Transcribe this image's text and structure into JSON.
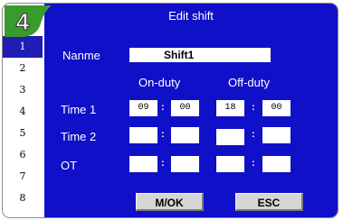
{
  "step_number": "4",
  "sidebar": {
    "items": [
      "1",
      "2",
      "3",
      "4",
      "5",
      "6",
      "7",
      "8"
    ],
    "active_index": 0
  },
  "dialog": {
    "title": "Edit shift",
    "name_label": "Nanme",
    "name_value": "Shift1",
    "on_duty_label": "On-duty",
    "off_duty_label": "Off-duty",
    "separator": ":",
    "rows": [
      {
        "label": "Time 1",
        "on_hour": "09",
        "on_min": "00",
        "off_hour": "18",
        "off_min": "00"
      },
      {
        "label": "Time 2",
        "on_hour": "",
        "on_min": "",
        "off_hour": "",
        "off_min": ""
      },
      {
        "label": "OT",
        "on_hour": "",
        "on_min": "",
        "off_hour": "",
        "off_min": ""
      }
    ],
    "ok_label": "M/OK",
    "esc_label": "ESC"
  },
  "colors": {
    "panel": "#1010c8",
    "sidebar_active": "#1e1eb4",
    "badge": "#3a9a2e"
  }
}
